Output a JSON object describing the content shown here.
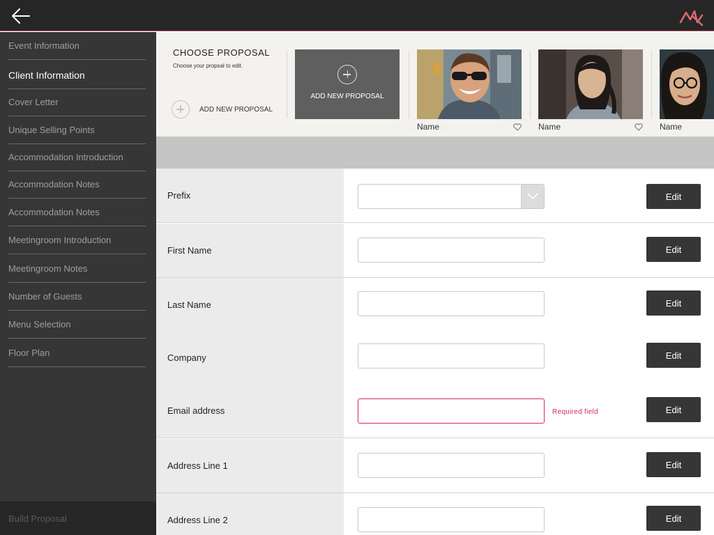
{
  "header": {
    "back_icon": "arrow-left-icon",
    "logo_icon": "brand-logo-icon",
    "accent_color": "#e06a72"
  },
  "sidebar": {
    "items": [
      {
        "label": "Event Information",
        "active": false
      },
      {
        "label": "Client Information",
        "active": true
      },
      {
        "label": "Cover Letter",
        "active": false
      },
      {
        "label": "Unique Selling Points",
        "active": false
      },
      {
        "label": "Accommodation Introduction",
        "active": false
      },
      {
        "label": "Accommodation Notes",
        "active": false
      },
      {
        "label": "Accommodation Notes",
        "active": false
      },
      {
        "label": "Meetingroom Introduction",
        "active": false
      },
      {
        "label": "Meetingroom Notes",
        "active": false
      },
      {
        "label": "Number of Guests",
        "active": false
      },
      {
        "label": "Menu Selection",
        "active": false
      },
      {
        "label": "Floor Plan",
        "active": false
      }
    ],
    "build_label": "Build Proposal"
  },
  "proposals": {
    "title": "CHOOSE PROPOSAL",
    "subtitle": "Choose your propsal to edit.",
    "add_new_label": "ADD NEW PROPOSAL",
    "add_card_label": "ADD NEW PROPOSAL",
    "cards": [
      {
        "name": "Name",
        "favorite_icon": "heart-icon"
      },
      {
        "name": "Name",
        "favorite_icon": "heart-icon"
      },
      {
        "name": "Name",
        "favorite_icon": "heart-icon"
      }
    ]
  },
  "form": {
    "edit_label": "Edit",
    "rows": [
      {
        "label": "Prefix",
        "type": "select",
        "value": ""
      },
      {
        "label": "First Name",
        "type": "text",
        "value": ""
      },
      {
        "label": "Last Name",
        "type": "text",
        "value": ""
      },
      {
        "label": "Company",
        "type": "text",
        "value": ""
      },
      {
        "label": "Email address",
        "type": "text",
        "value": "",
        "error": "Required field"
      },
      {
        "label": "Address Line 1",
        "type": "text",
        "value": ""
      },
      {
        "label": "Address Line 2",
        "type": "text",
        "value": ""
      }
    ],
    "error_color": "#d8246b"
  }
}
